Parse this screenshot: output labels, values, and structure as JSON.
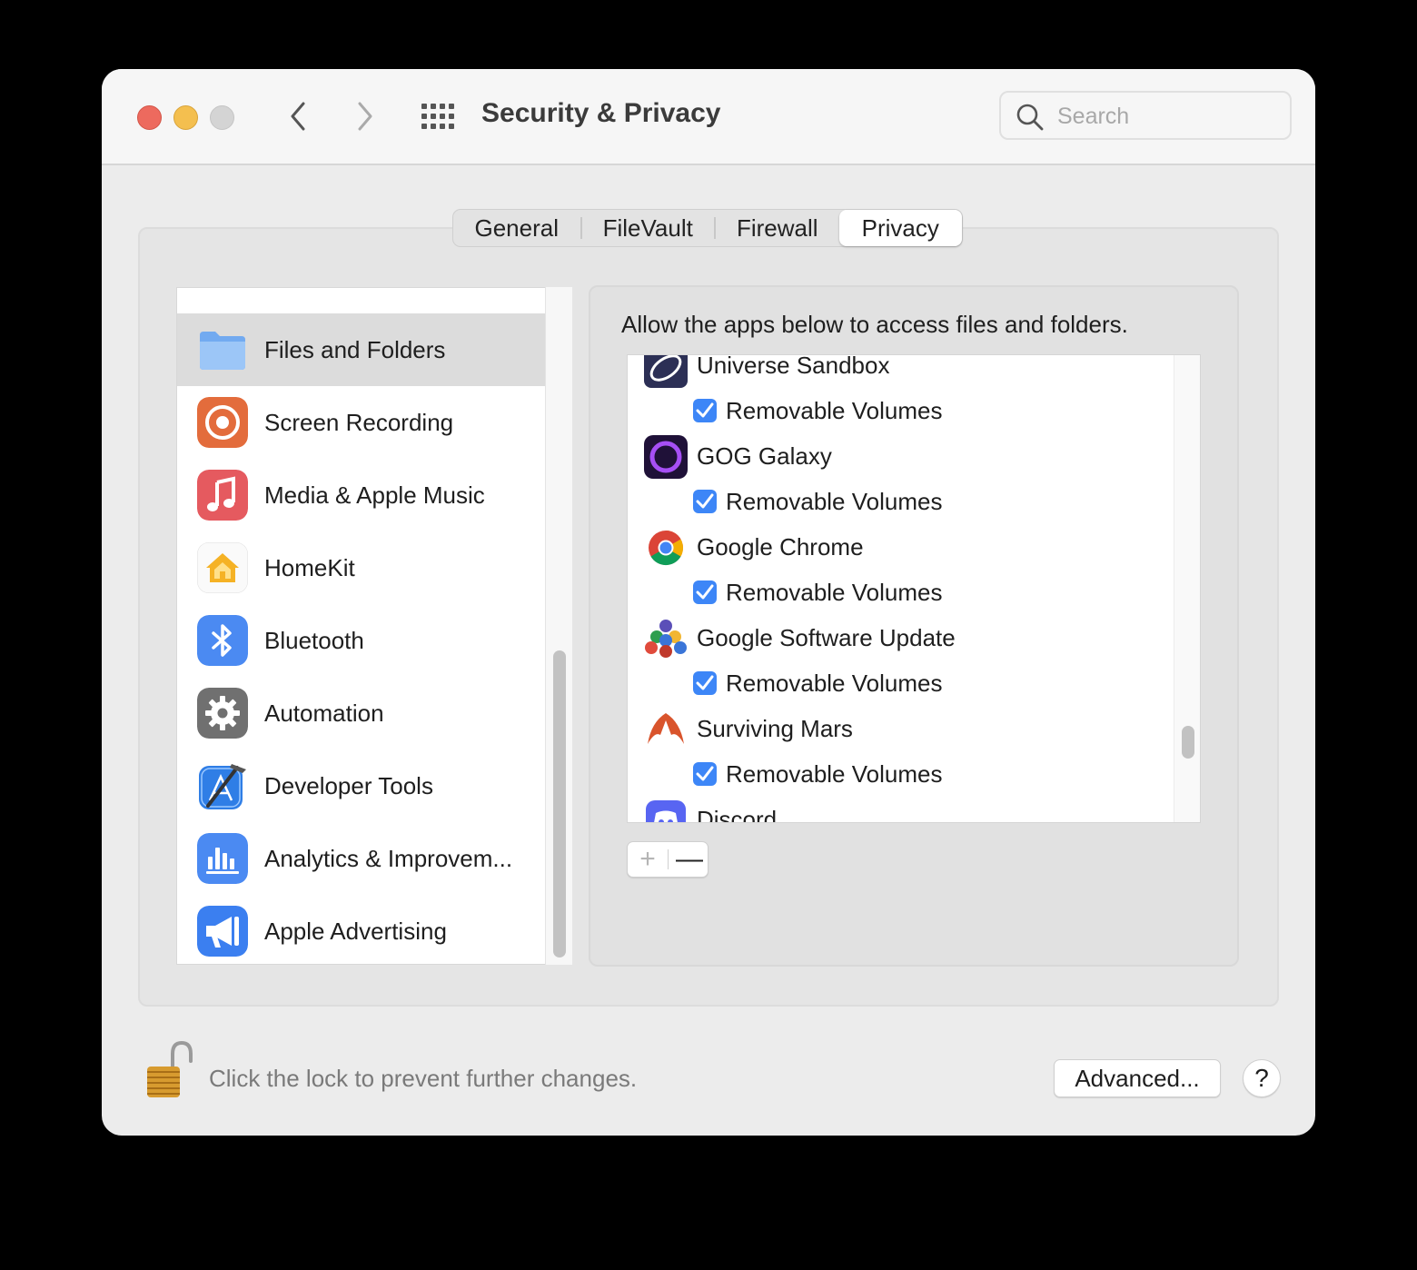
{
  "window": {
    "title": "Security & Privacy"
  },
  "search": {
    "placeholder": "Search"
  },
  "tabs": [
    {
      "label": "General"
    },
    {
      "label": "FileVault"
    },
    {
      "label": "Firewall"
    },
    {
      "label": "Privacy",
      "selected": true
    }
  ],
  "sidebar": {
    "items": [
      {
        "label": "Files and Folders",
        "icon": "folder-icon",
        "selected": true
      },
      {
        "label": "Screen Recording",
        "icon": "screen-recording-icon"
      },
      {
        "label": "Media & Apple Music",
        "icon": "music-note-icon"
      },
      {
        "label": "HomeKit",
        "icon": "home-icon"
      },
      {
        "label": "Bluetooth",
        "icon": "bluetooth-icon"
      },
      {
        "label": "Automation",
        "icon": "gear-icon"
      },
      {
        "label": "Developer Tools",
        "icon": "developer-tools-icon"
      },
      {
        "label": "Analytics & Improvem...",
        "icon": "analytics-icon"
      },
      {
        "label": "Apple Advertising",
        "icon": "megaphone-icon"
      }
    ]
  },
  "main": {
    "caption": "Allow the apps below to access files and folders.",
    "apps": [
      {
        "name": "Universe Sandbox",
        "icon": "universe-sandbox-icon",
        "permission": "Removable Volumes",
        "checked": true
      },
      {
        "name": "GOG Galaxy",
        "icon": "gog-galaxy-icon",
        "permission": "Removable Volumes",
        "checked": true
      },
      {
        "name": "Google Chrome",
        "icon": "chrome-icon",
        "permission": "Removable Volumes",
        "checked": true
      },
      {
        "name": "Google Software Update",
        "icon": "google-software-update-icon",
        "permission": "Removable Volumes",
        "checked": true
      },
      {
        "name": "Surviving Mars",
        "icon": "surviving-mars-icon",
        "permission": "Removable Volumes",
        "checked": true
      },
      {
        "name": "Discord",
        "icon": "discord-icon"
      }
    ],
    "add_label": "+",
    "remove_label": "—"
  },
  "footer": {
    "lock_text": "Click the lock to prevent further changes.",
    "advanced_label": "Advanced...",
    "help_label": "?"
  },
  "colors": {
    "checkbox": "#3d86f7",
    "selected_row": "#dcdcdc"
  }
}
